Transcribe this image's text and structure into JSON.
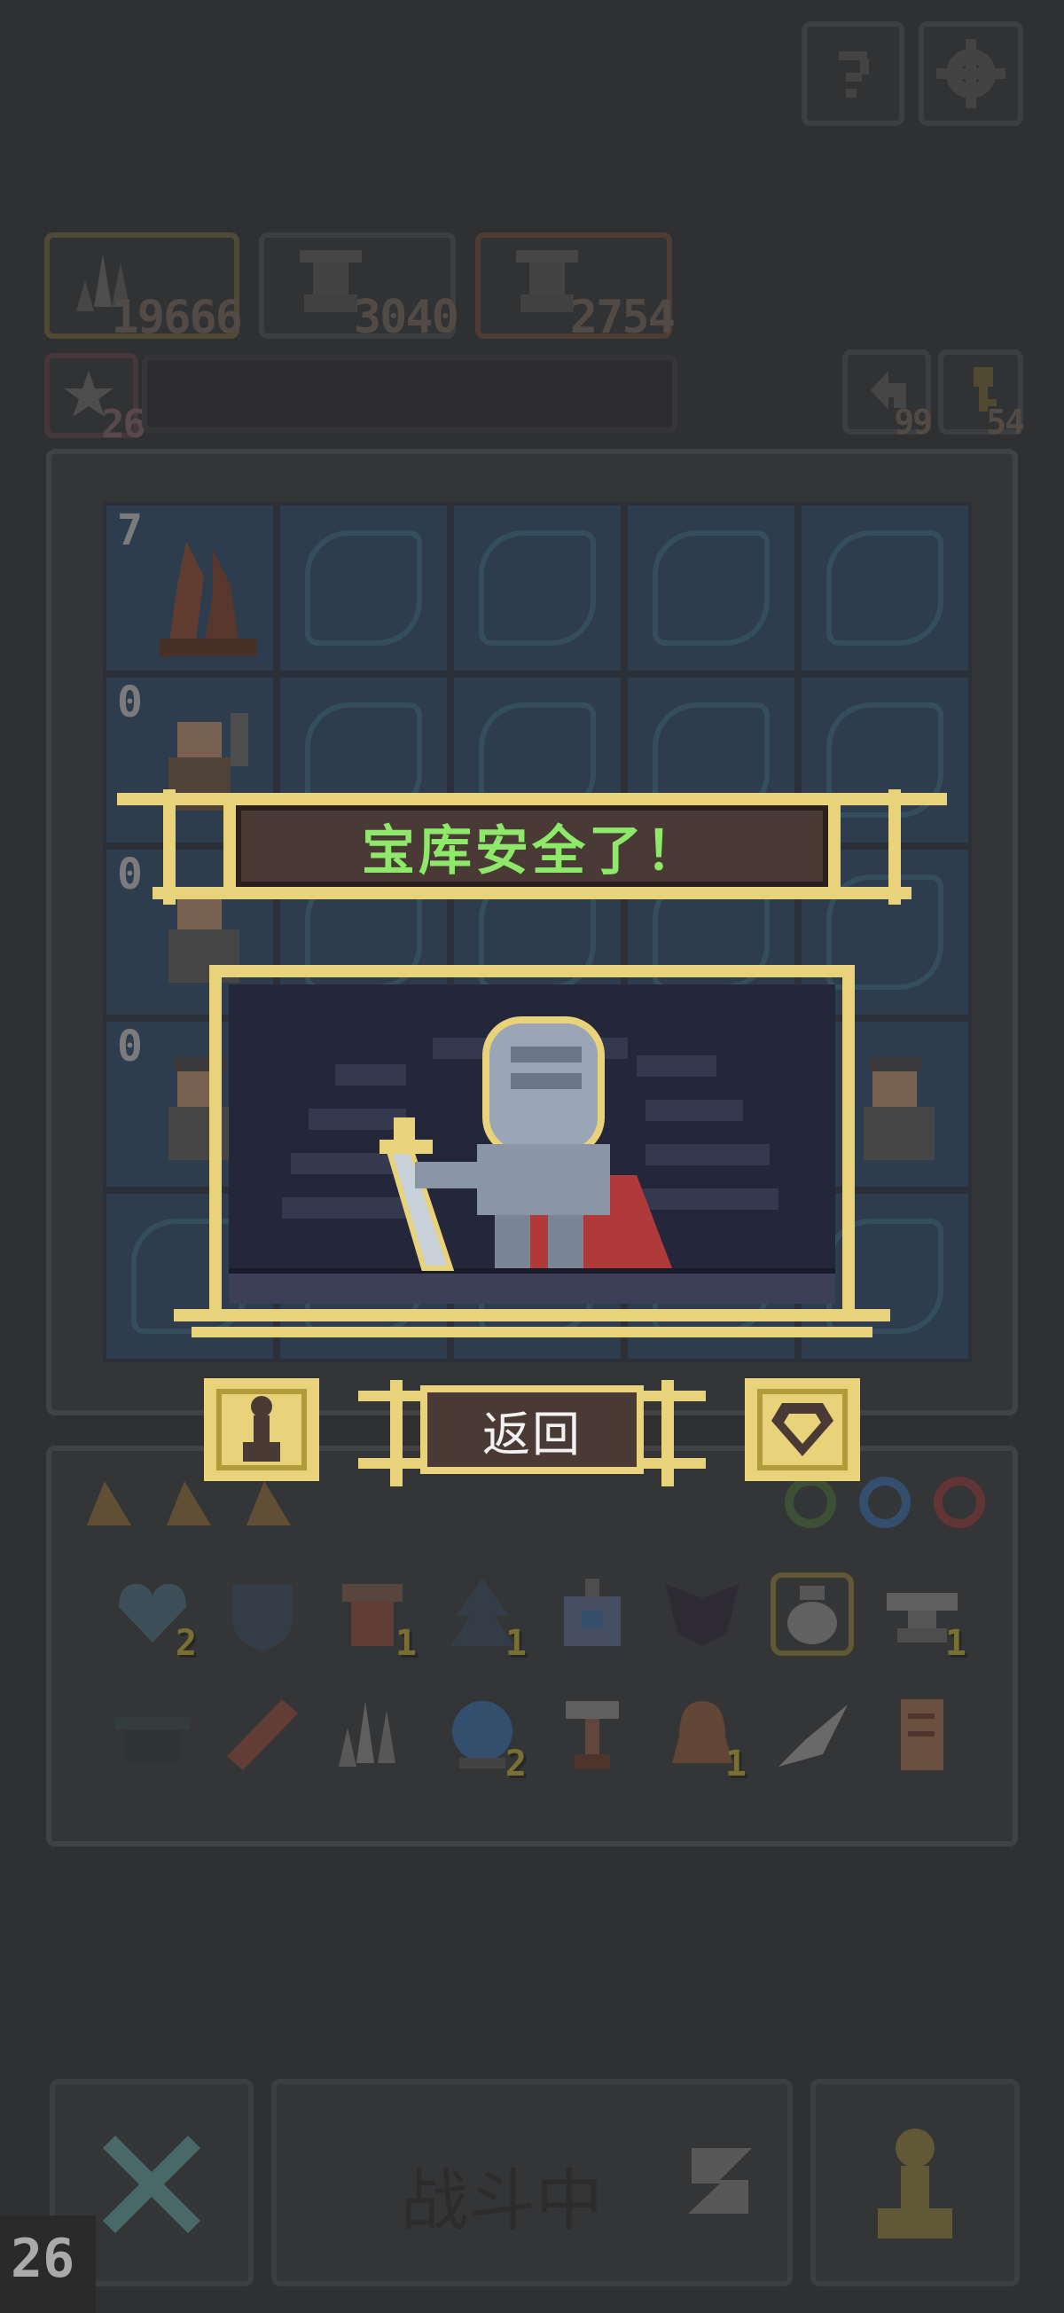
{
  "top_buttons": {
    "help_icon": "question-icon",
    "settings_icon": "gear-icon"
  },
  "resources": [
    {
      "icon": "crystal-icon",
      "value": "19666"
    },
    {
      "icon": "goblin-icon",
      "value": "3040"
    },
    {
      "icon": "goblin-icon",
      "value": "2754"
    }
  ],
  "level": {
    "icon": "star-icon",
    "value": "26"
  },
  "counters": [
    {
      "icon": "arrow-icon",
      "value": "99"
    },
    {
      "icon": "key-icon",
      "value": "54"
    }
  ],
  "grid": {
    "rows": [
      {
        "count": "7",
        "unit": "tree-stump"
      },
      {
        "count": "0",
        "unit": "dwarf-axe"
      },
      {
        "count": "0",
        "unit": "dwarf-gunner"
      },
      {
        "count": "0",
        "unit": "dwarf-gunner"
      },
      {
        "count": "",
        "unit": ""
      }
    ]
  },
  "popup": {
    "banner": "宝库安全了！",
    "portrait": "armored-knight",
    "return_label": "返回",
    "left_icon": "pawn-icon",
    "right_icon": "gem-icon"
  },
  "inventory": {
    "row1": [
      {
        "icon": "heart-shield-icon",
        "qty": "2"
      },
      {
        "icon": "shield-icon",
        "qty": ""
      },
      {
        "icon": "scroll-box-icon",
        "qty": "1"
      },
      {
        "icon": "tree-icon",
        "qty": "1"
      },
      {
        "icon": "potion-bottle-icon",
        "qty": ""
      },
      {
        "icon": "bat-icon",
        "qty": ""
      },
      {
        "icon": "vase-icon",
        "qty": ""
      },
      {
        "icon": "anvil-icon",
        "qty": "1"
      }
    ],
    "row2": [
      {
        "icon": "cauldron-icon",
        "qty": ""
      },
      {
        "icon": "plank-icon",
        "qty": ""
      },
      {
        "icon": "crystal-icon",
        "qty": ""
      },
      {
        "icon": "orb-icon",
        "qty": "2"
      },
      {
        "icon": "hammer-icon",
        "qty": ""
      },
      {
        "icon": "bell-icon",
        "qty": "1"
      },
      {
        "icon": "feather-icon",
        "qty": ""
      },
      {
        "icon": "parchment-icon",
        "qty": ""
      }
    ]
  },
  "bottom": {
    "battle_label": "战斗中",
    "cancel_icon": "close-icon",
    "speed_icon": "z-icon",
    "pawn_icon": "pawn-icon",
    "wave_number": "26"
  },
  "colors": {
    "banner_text": "#8ee86a",
    "gold": "#e8d27a",
    "panel": "#4a3a35"
  }
}
